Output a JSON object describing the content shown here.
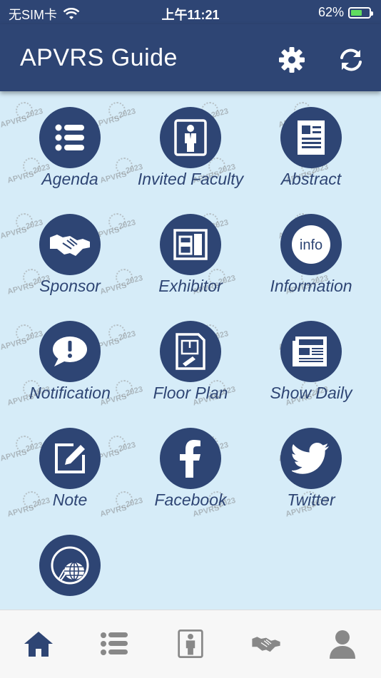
{
  "status_bar": {
    "carrier": "无SIM卡",
    "time": "上午11:21",
    "battery_percent": "62%",
    "battery_level": 0.62,
    "battery_color": "#5fdc5f"
  },
  "app_bar": {
    "title": "APVRS Guide",
    "background": "#2e4574",
    "settings_icon": "gear-icon",
    "refresh_icon": "refresh-icon"
  },
  "watermark": {
    "line1": "APVRS",
    "line2": "2023"
  },
  "menu": [
    {
      "label": "Agenda",
      "icon": "list-icon"
    },
    {
      "label": "Invited Faculty",
      "icon": "person-frame-icon"
    },
    {
      "label": "Abstract",
      "icon": "document-icon"
    },
    {
      "label": "Sponsor",
      "icon": "handshake-icon"
    },
    {
      "label": "Exhibitor",
      "icon": "booth-icon"
    },
    {
      "label": "Information",
      "icon": "info-icon"
    },
    {
      "label": "Notification",
      "icon": "speech-bubble-icon"
    },
    {
      "label": "Floor Plan",
      "icon": "floor-plan-icon"
    },
    {
      "label": "Show Daily",
      "icon": "newspaper-icon"
    },
    {
      "label": "Note",
      "icon": "note-edit-icon"
    },
    {
      "label": "Facebook",
      "icon": "facebook-icon"
    },
    {
      "label": "Twitter",
      "icon": "twitter-icon"
    },
    {
      "label": "",
      "icon": "globe-icon"
    }
  ],
  "info_text": "info",
  "tab_bar": {
    "tabs": [
      {
        "icon": "home-icon",
        "active": true
      },
      {
        "icon": "list-icon",
        "active": false
      },
      {
        "icon": "person-frame-icon",
        "active": false
      },
      {
        "icon": "handshake-icon",
        "active": false
      },
      {
        "icon": "user-icon",
        "active": false
      }
    ],
    "active_color": "#2e4574",
    "inactive_color": "#888888"
  }
}
